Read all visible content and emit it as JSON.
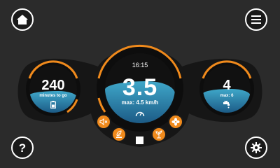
{
  "colors": {
    "background": "#2b2b2b",
    "accent": "#f08a1c",
    "water_light": "#3fa7c9",
    "water_dark": "#1c5b86"
  },
  "icons": {
    "home": "home-icon",
    "menu": "menu-icon",
    "help": "help-icon",
    "settings": "gear-icon",
    "battery": "battery-icon",
    "tap": "water-tap-icon",
    "speedometer": "speedometer-icon",
    "mute": "speaker-mute-icon",
    "eco": "eco-leaf-icon",
    "plant": "plant-icon",
    "fan": "fan-icon",
    "stop": "stop-icon"
  },
  "help_glyph": "?",
  "main_gauge": {
    "time": "16:15",
    "speed": "3.5",
    "max_label": "max: 4.5 km/h",
    "level": 0.6
  },
  "left_gauge": {
    "value": "240",
    "label": "minutes to go",
    "level": 0.45
  },
  "right_gauge": {
    "value": "4",
    "max_label": "max: 6",
    "level": 0.5
  }
}
